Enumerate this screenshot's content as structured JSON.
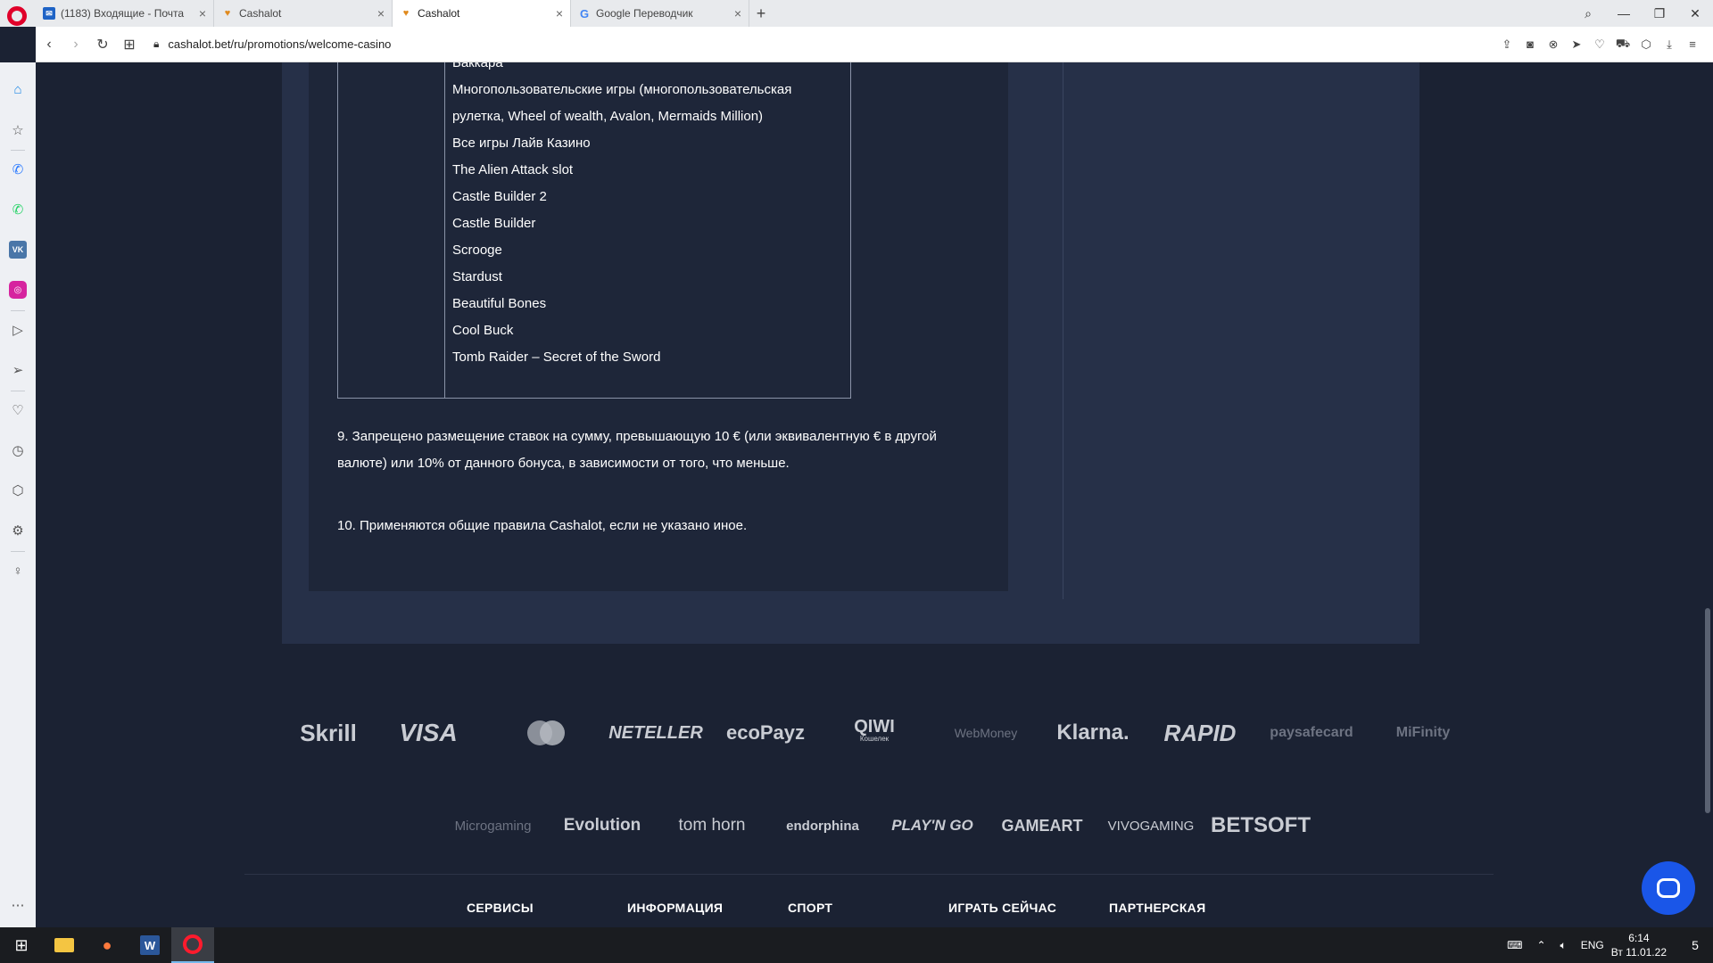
{
  "browser": {
    "tabs": [
      {
        "title": "(1183) Входящие - Почта",
        "favicon": "mail-icon",
        "active": false
      },
      {
        "title": "Cashalot",
        "favicon": "cashalot-icon",
        "active": false
      },
      {
        "title": "Cashalot",
        "favicon": "cashalot-icon",
        "active": true
      },
      {
        "title": "Google Переводчик",
        "favicon": "google-translate-icon",
        "active": false
      }
    ],
    "new_tab": "+",
    "url": "cashalot.bet/ru/promotions/welcome-casino"
  },
  "sidebar": {
    "vk_label": "VK",
    "ig_label": "◎"
  },
  "page": {
    "games": [
      "Баккара",
      "Многопользовательские игры (многопользовательская",
      "рулетка, Wheel of wealth, Avalon, Mermaids Million)",
      "Все игры Лайв Казино",
      "The Alien Attack slot",
      "Castle Builder 2",
      "Castle Builder",
      "Scrooge",
      "Stardust",
      "Beautiful Bones",
      "Cool Buck",
      "Tomb Raider – Secret of the Sword"
    ],
    "rule9_line1": "9. Запрещено размещение ставок на сумму, превышающую 10 € (или эквивалентную € в другой",
    "rule9_line2": "валюте) или 10% от данного бонуса, в зависимости от того, что меньше.",
    "rule10": "10. Применяются общие правила Cashalot, если не указано иное."
  },
  "payment_logos": [
    "Skrill",
    "VISA",
    "",
    "NETELLER",
    "ecoPayz",
    "QIWI",
    "WebMoney",
    "Klarna.",
    "RAPID",
    "paysafecard",
    "MiFinity"
  ],
  "qiwi_sub": "Кошелек",
  "provider_logos": [
    "Microgaming",
    "Evolution",
    "tom horn",
    "endorphina",
    "PLAY'N GO",
    "GAMEART",
    "VIVOGAMING",
    "BETSOFT"
  ],
  "footer_nav": [
    "СЕРВИСЫ",
    "ИНФОРМАЦИЯ",
    "СПОРТ",
    "ИГРАТЬ СЕЙЧАС",
    "ПАРТНЕРСКАЯ"
  ],
  "taskbar": {
    "language": "ENG",
    "time": "6:14",
    "date": "Вт 11.01.22",
    "notifications": "5"
  }
}
